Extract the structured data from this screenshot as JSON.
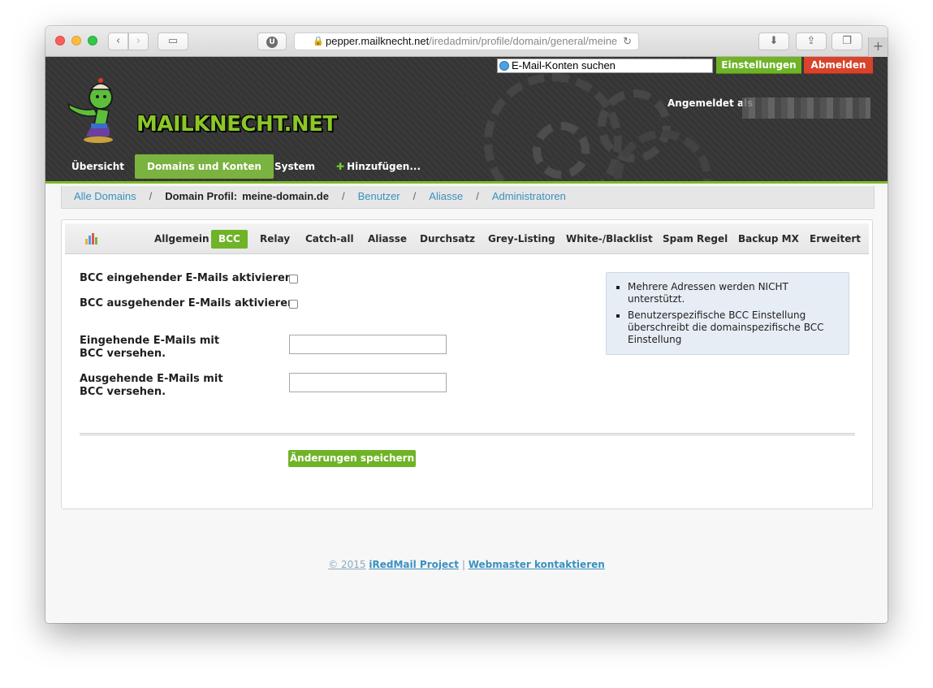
{
  "browser": {
    "url_host": "pepper.mailknecht.net",
    "url_path": "/iredadmin/profile/domain/general/meine",
    "shield_label": "U"
  },
  "header": {
    "logo_text": "MAILKNECHT.NET",
    "search_placeholder": "E-Mail-Konten suchen",
    "settings_label": "Einstellungen",
    "logout_label": "Abmelden",
    "logged_in_label": "Angemeldet als"
  },
  "mainnav": {
    "items": [
      {
        "label": "Übersicht"
      },
      {
        "label": "Domains und Konten"
      },
      {
        "label": "System"
      },
      {
        "label": "Hinzufügen..."
      }
    ]
  },
  "breadcrumb": {
    "all_domains": "Alle Domains",
    "profile_label": "Domain Profil:",
    "domain": "meine-domain.de",
    "users": "Benutzer",
    "aliases": "Aliasse",
    "admins": "Administratoren"
  },
  "tabs": [
    {
      "label": "Allgemein"
    },
    {
      "label": "BCC"
    },
    {
      "label": "Relay"
    },
    {
      "label": "Catch-all"
    },
    {
      "label": "Aliasse"
    },
    {
      "label": "Durchsatz"
    },
    {
      "label": "Grey-Listing"
    },
    {
      "label": "White-/Blacklist"
    },
    {
      "label": "Spam Regel"
    },
    {
      "label": "Backup MX"
    },
    {
      "label": "Erweitert"
    }
  ],
  "form": {
    "bcc_incoming_label": "BCC eingehender E-Mails aktivieren",
    "bcc_outgoing_label": "BCC ausgehender E-Mails aktivieren",
    "incoming_address_label": "Eingehende E-Mails mit BCC versehen.",
    "outgoing_address_label": "Ausgehende E-Mails mit BCC versehen.",
    "incoming_address_value": "",
    "outgoing_address_value": "",
    "save_label": "Änderungen speichern"
  },
  "info": {
    "items": [
      "Mehrere Adressen werden NICHT unterstützt.",
      "Benutzerspezifische BCC Einstellung überschreibt die domainspezifische BCC Einstellung"
    ]
  },
  "footer": {
    "copyright": "© 2015",
    "project_link": "iRedMail Project",
    "separator": "|",
    "webmaster_link": "Webmaster kontaktieren"
  },
  "colors": {
    "accent_green": "#6fb327",
    "logout_red": "#d8432c",
    "link_blue": "#3a90c1",
    "header_dark": "#353535"
  }
}
